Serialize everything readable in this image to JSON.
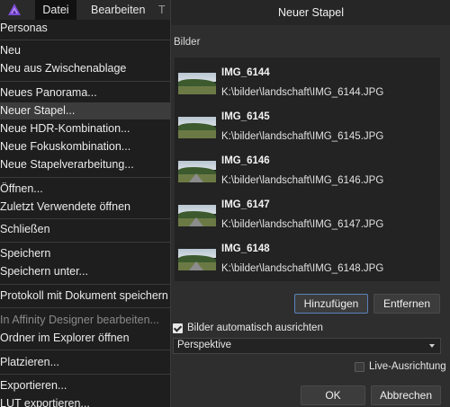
{
  "menubar": {
    "logo_icon": "affinity-photo-logo-icon",
    "file_label": "Datei",
    "edit_label": "Bearbeiten",
    "more_label": "T"
  },
  "file_menu": {
    "items": [
      {
        "label": "Personas",
        "disabled": false
      },
      {
        "label": "Neu",
        "disabled": false
      },
      {
        "label": "Neu aus Zwischenablage",
        "disabled": false
      },
      {
        "label": "Neues Panorama...",
        "disabled": false
      },
      {
        "label": "Neuer Stapel...",
        "disabled": false,
        "highlighted": true
      },
      {
        "label": "Neue HDR-Kombination...",
        "disabled": false
      },
      {
        "label": "Neue Fokuskombination...",
        "disabled": false
      },
      {
        "label": "Neue Stapelverarbeitung...",
        "disabled": false
      },
      {
        "label": "Öffnen...",
        "disabled": false
      },
      {
        "label": "Zuletzt Verwendete öffnen",
        "disabled": false
      },
      {
        "label": "Schließen",
        "disabled": false
      },
      {
        "label": "Speichern",
        "disabled": false
      },
      {
        "label": "Speichern unter...",
        "disabled": false
      },
      {
        "label": "Protokoll mit Dokument speichern",
        "disabled": false
      },
      {
        "label": "In Affinity Designer bearbeiten...",
        "disabled": true
      },
      {
        "label": "Ordner im Explorer öffnen",
        "disabled": false
      },
      {
        "label": "Platzieren...",
        "disabled": false
      },
      {
        "label": "Exportieren...",
        "disabled": false
      },
      {
        "label": "LUT exportieren...",
        "disabled": false
      }
    ]
  },
  "dialog": {
    "title": "Neuer Stapel",
    "images_label": "Bilder",
    "images": [
      {
        "name": "IMG_6144",
        "path": "K:\\bilder\\landschaft\\IMG_6144.JPG"
      },
      {
        "name": "IMG_6145",
        "path": "K:\\bilder\\landschaft\\IMG_6145.JPG"
      },
      {
        "name": "IMG_6146",
        "path": "K:\\bilder\\landschaft\\IMG_6146.JPG"
      },
      {
        "name": "IMG_6147",
        "path": "K:\\bilder\\landschaft\\IMG_6147.JPG"
      },
      {
        "name": "IMG_6148",
        "path": "K:\\bilder\\landschaft\\IMG_6148.JPG"
      }
    ],
    "add_button": "Hinzufügen",
    "remove_button": "Entfernen",
    "auto_align_label": "Bilder automatisch ausrichten",
    "auto_align_checked": true,
    "alignment_mode": "Perspektive",
    "live_align_label": "Live-Ausrichtung",
    "live_align_checked": false,
    "ok_button": "OK",
    "cancel_button": "Abbrechen"
  },
  "colors": {
    "menu_bg": "#1e1e1e",
    "dialog_bg": "#2e2e2e",
    "highlight_bg": "#3c3c3c",
    "accent_border": "#5b82b9",
    "logo_purple": "#7b4bd6"
  }
}
